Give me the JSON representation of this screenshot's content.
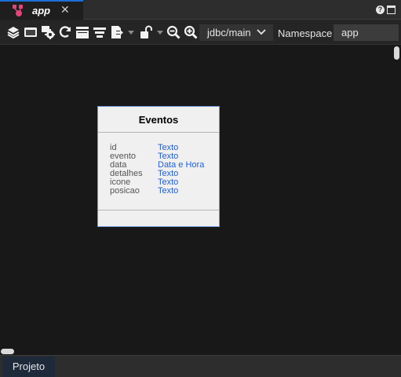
{
  "tab": {
    "title": "app",
    "app_icon": "entity-diagram-icon",
    "close_icon": "close-icon",
    "help_icon": "question-icon",
    "maximize_icon": "maximize-icon"
  },
  "toolbar": {
    "buttons": [
      {
        "name": "layers-button",
        "icon": "layers-icon"
      },
      {
        "name": "window-button",
        "icon": "window-icon"
      },
      {
        "name": "settings-button",
        "icon": "gear-icon"
      },
      {
        "name": "refresh-button",
        "icon": "refresh-icon"
      },
      {
        "name": "align-left-button",
        "icon": "align-left-icon"
      },
      {
        "name": "align-center-button",
        "icon": "align-center-icon"
      },
      {
        "name": "export-button",
        "icon": "export-icon"
      },
      {
        "name": "lock-button",
        "icon": "unlock-icon"
      },
      {
        "name": "zoom-out-button",
        "icon": "zoom-out-icon"
      },
      {
        "name": "zoom-in-button",
        "icon": "zoom-in-icon"
      }
    ],
    "db_select": {
      "value": "jdbc/main"
    },
    "namespace_label": "Namespace",
    "namespace_value": "app"
  },
  "entity": {
    "title": "Eventos",
    "fields": [
      {
        "name": "id",
        "type": "Texto"
      },
      {
        "name": "evento",
        "type": "Texto"
      },
      {
        "name": "data",
        "type": "Data e Hora"
      },
      {
        "name": "detalhes",
        "type": "Texto"
      },
      {
        "name": "icone",
        "type": "Texto"
      },
      {
        "name": "posicao",
        "type": "Texto"
      }
    ]
  },
  "bottom": {
    "tab_label": "Projeto"
  },
  "colors": {
    "accent": "#1e6fd9",
    "field_type": "#1f5fd6",
    "entity_border": "#6f9ad8",
    "app_icon": "#e0457b"
  }
}
